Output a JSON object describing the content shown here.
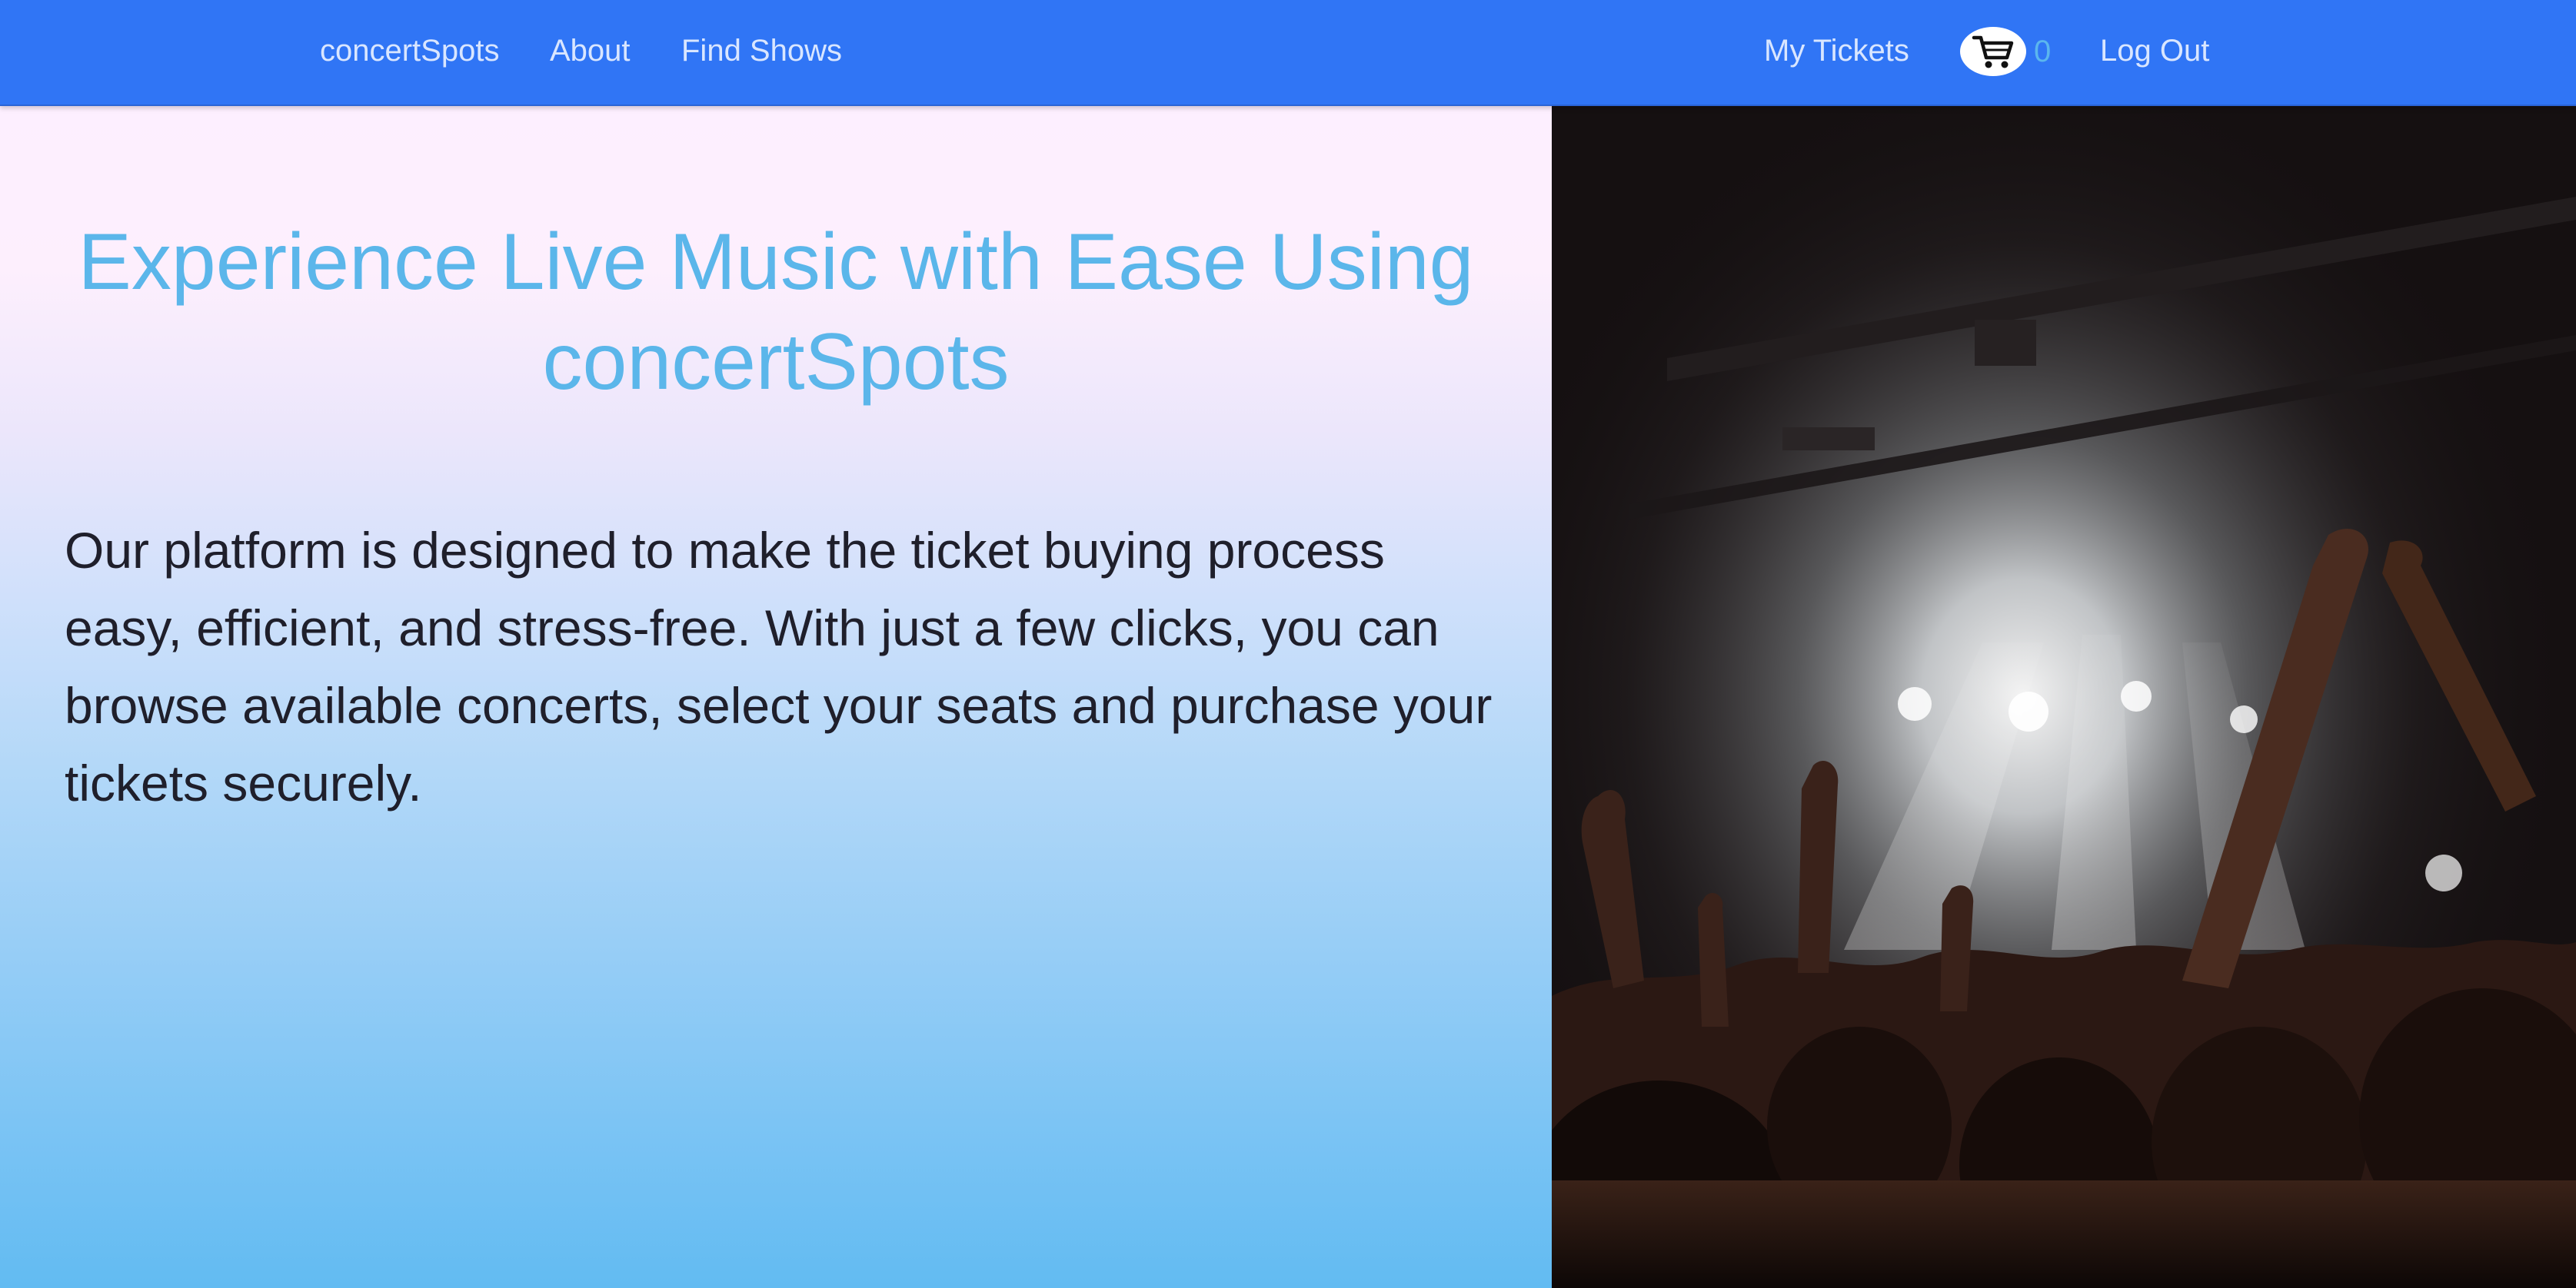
{
  "nav": {
    "brand": "concertSpots",
    "about": "About",
    "find_shows": "Find Shows",
    "my_tickets": "My Tickets",
    "cart_count": "0",
    "log_out": "Log Out",
    "cart_icon": "shopping-cart-icon"
  },
  "hero": {
    "title": "Experience Live Music with Ease Using concertSpots",
    "body": "Our platform is designed to make the ticket buying process easy, efficient, and stress-free. With just a few clicks, you can browse available concerts, select your seats and purchase your tickets securely."
  },
  "image": {
    "subject": "concert-crowd-photo"
  },
  "colors": {
    "navbar": "#3075f5",
    "title": "#5bb6ea",
    "body_text": "#1f1f2b"
  }
}
